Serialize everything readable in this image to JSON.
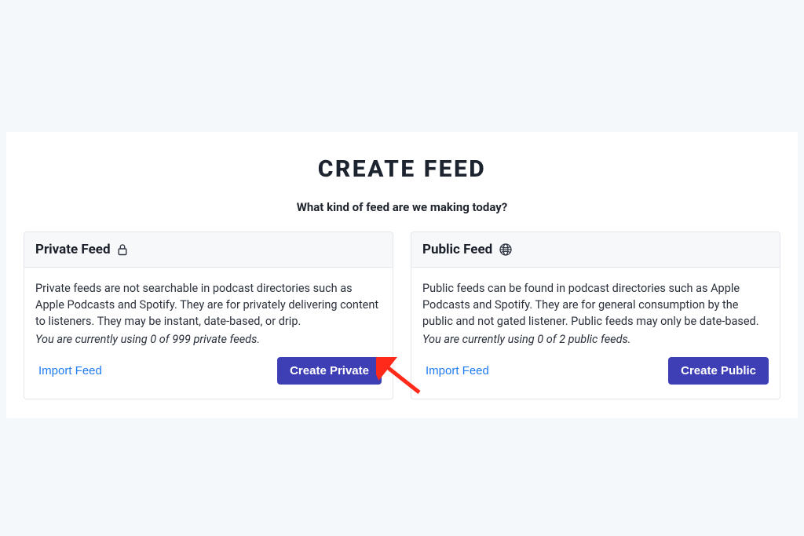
{
  "page": {
    "title": "CREATE FEED",
    "subtitle": "What kind of feed are we making today?"
  },
  "cards": {
    "private": {
      "title": "Private Feed",
      "icon": "lock-icon",
      "description": "Private feeds are not searchable in podcast directories such as Apple Podcasts and Spotify. They are for privately delivering content to listeners. They may be instant, date-based, or drip.",
      "usage": "You are currently using 0 of 999 private feeds.",
      "import_label": "Import Feed",
      "create_label": "Create Private"
    },
    "public": {
      "title": "Public Feed",
      "icon": "globe-icon",
      "description": "Public feeds can be found in podcast directories such as Apple Podcasts and Spotify. They are for general consumption by the public and not gated listener. Public feeds may only be date-based.",
      "usage": "You are currently using 0 of 2 public feeds.",
      "import_label": "Import Feed",
      "create_label": "Create Public"
    }
  },
  "annotation": {
    "arrow_target": "create-private-button",
    "arrow_color": "#ff2a1a"
  }
}
